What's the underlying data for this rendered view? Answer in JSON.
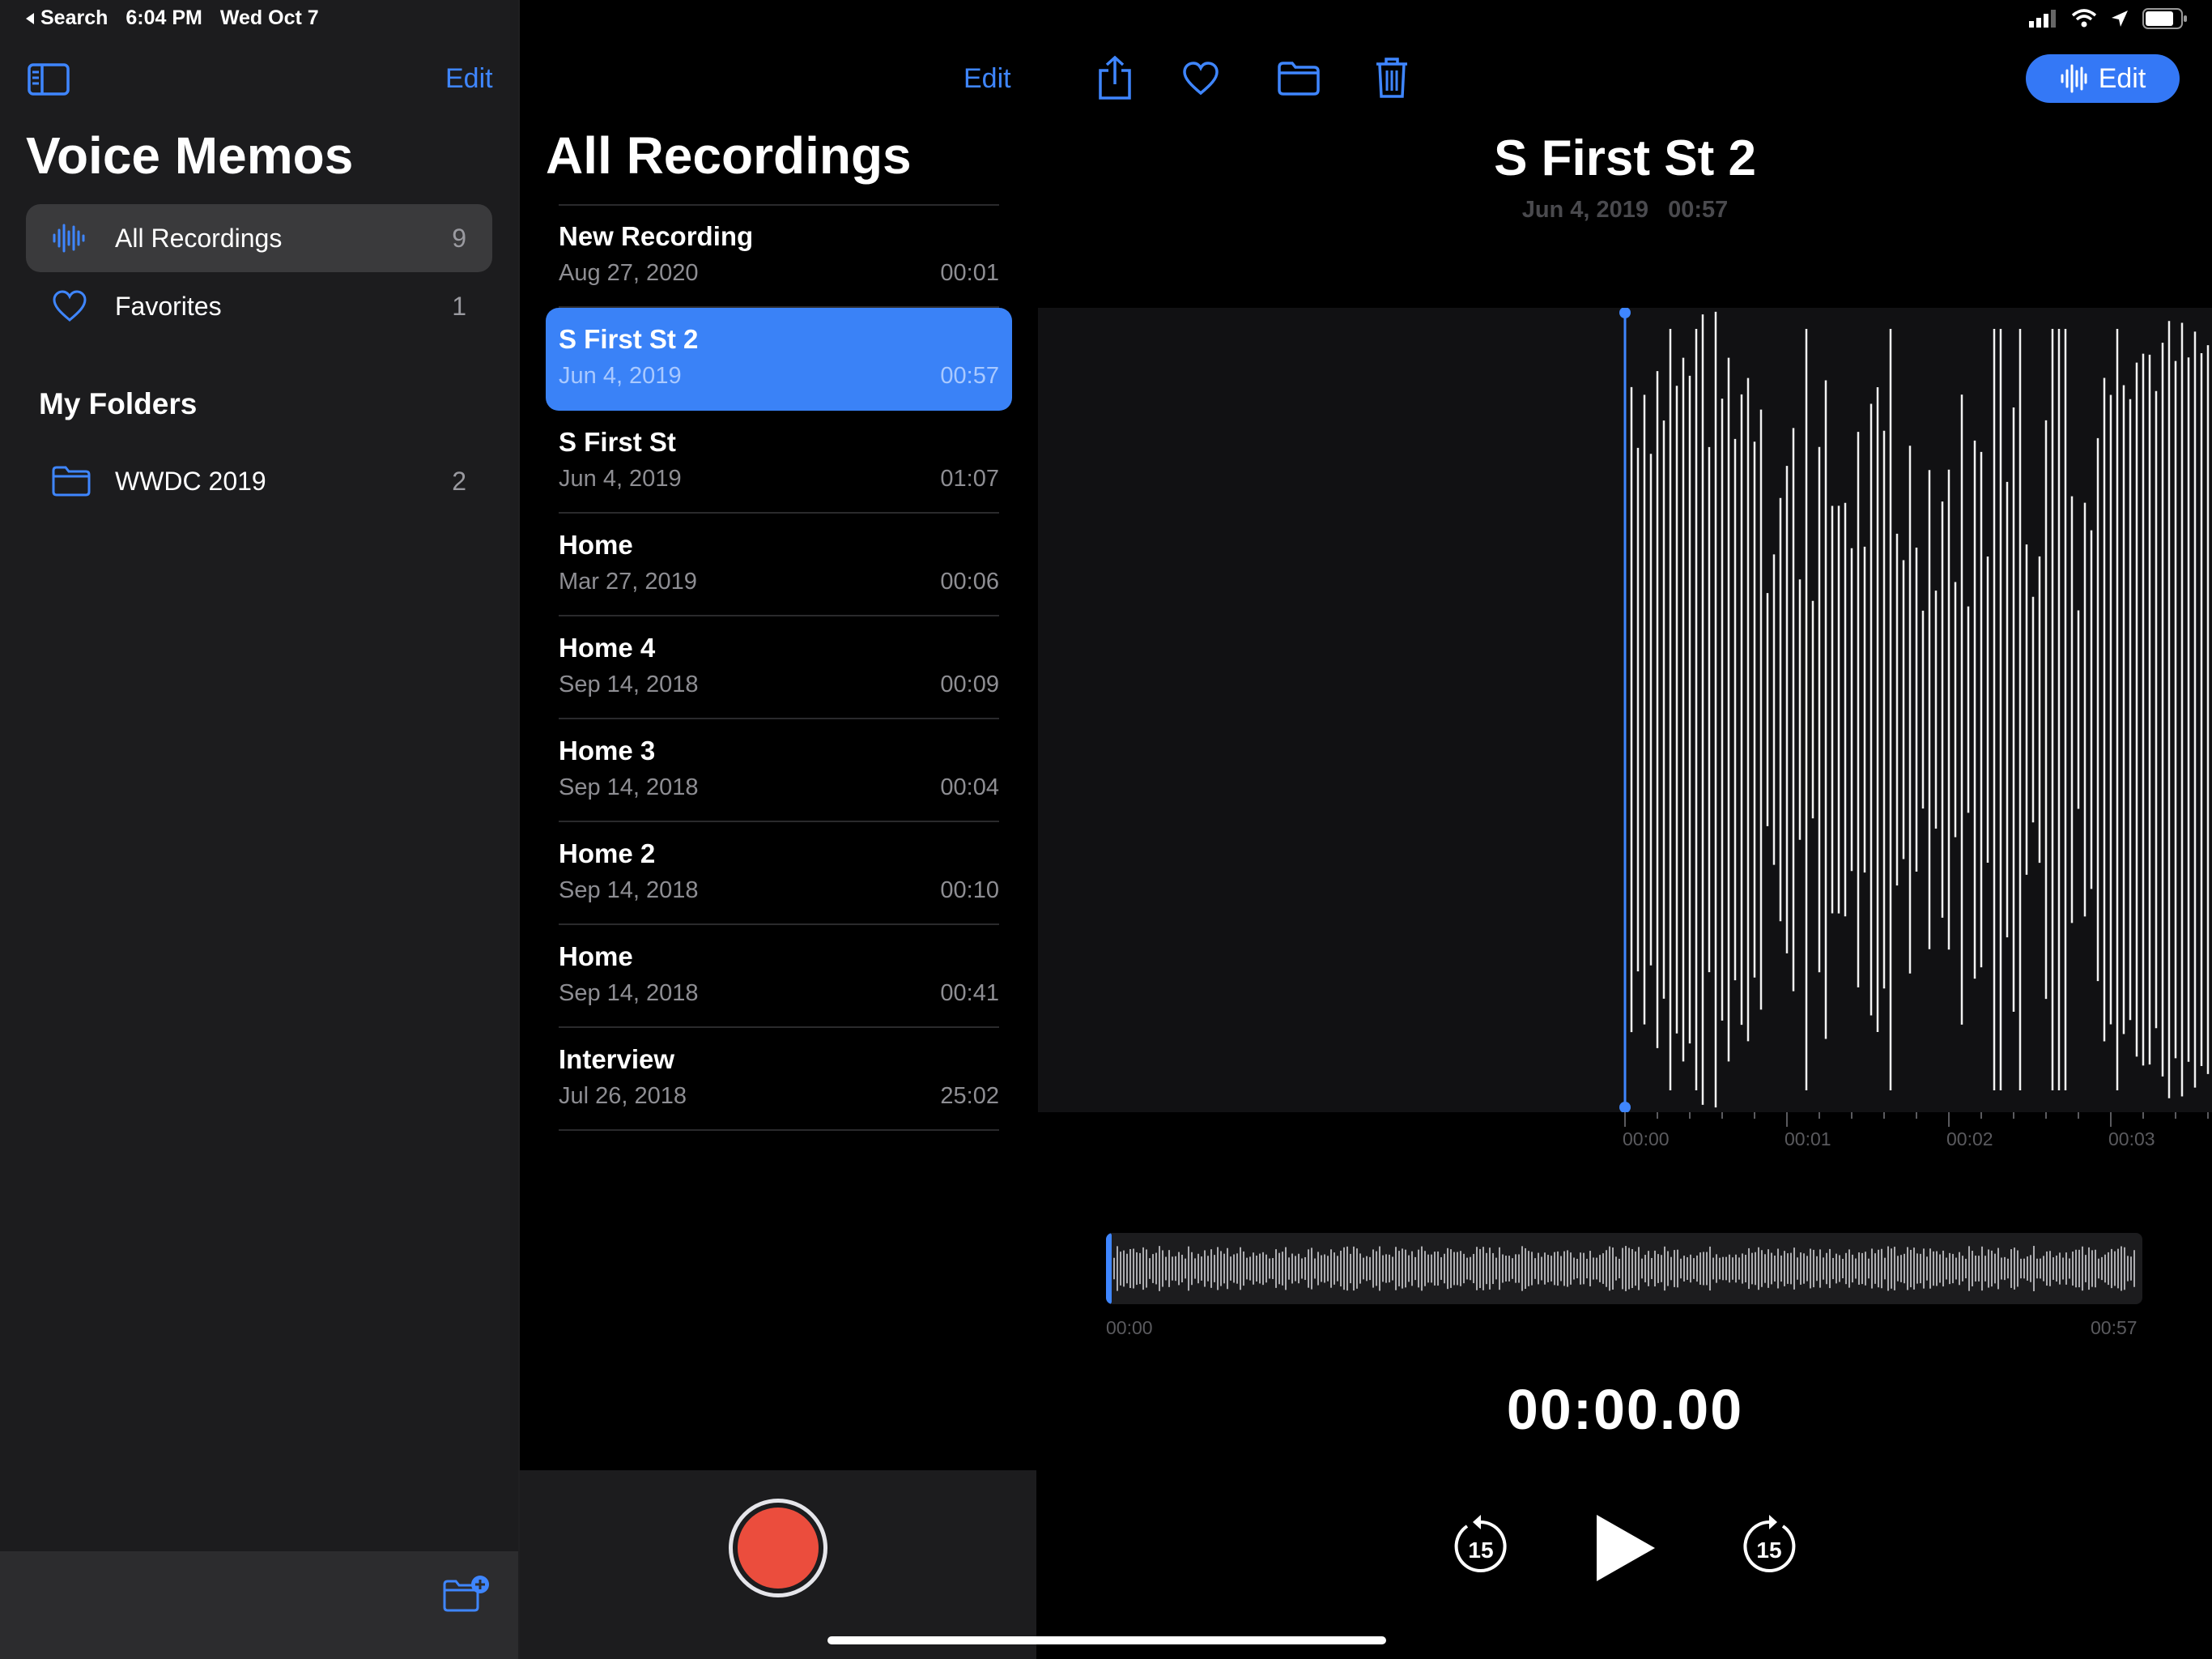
{
  "status_bar": {
    "back_label": "Search",
    "time": "6:04 PM",
    "date": "Wed Oct 7"
  },
  "sidebar": {
    "edit_label": "Edit",
    "title": "Voice Memos",
    "items": [
      {
        "icon": "waveform-icon",
        "label": "All Recordings",
        "count": "9",
        "selected": true
      },
      {
        "icon": "heart-icon",
        "label": "Favorites",
        "count": "1",
        "selected": false
      }
    ],
    "folders_title": "My Folders",
    "folders": [
      {
        "icon": "folder-icon",
        "label": "WWDC 2019",
        "count": "2"
      }
    ]
  },
  "list": {
    "edit_label": "Edit",
    "title": "All Recordings",
    "recordings": [
      {
        "name": "New Recording",
        "date": "Aug 27, 2020",
        "duration": "00:01"
      },
      {
        "name": "S First St 2",
        "date": "Jun 4, 2019",
        "duration": "00:57",
        "selected": true
      },
      {
        "name": "S First St",
        "date": "Jun 4, 2019",
        "duration": "01:07"
      },
      {
        "name": "Home",
        "date": "Mar 27, 2019",
        "duration": "00:06"
      },
      {
        "name": "Home 4",
        "date": "Sep 14, 2018",
        "duration": "00:09"
      },
      {
        "name": "Home 3",
        "date": "Sep 14, 2018",
        "duration": "00:04"
      },
      {
        "name": "Home 2",
        "date": "Sep 14, 2018",
        "duration": "00:10"
      },
      {
        "name": "Home",
        "date": "Sep 14, 2018",
        "duration": "00:41"
      },
      {
        "name": "Interview",
        "date": "Jul 26, 2018",
        "duration": "25:02"
      }
    ]
  },
  "detail": {
    "edit_label": "Edit",
    "title": "S First St 2",
    "date": "Jun 4, 2019",
    "duration": "00:57",
    "ticks": [
      "00:00",
      "00:01",
      "00:02",
      "00:03"
    ],
    "mini_start": "00:00",
    "mini_end": "00:57",
    "timer": "00:00.00",
    "skip_seconds": "15"
  },
  "colors": {
    "accent": "#3a82f7",
    "record": "#eb4d3d",
    "sidebar_bg": "#1c1c1e",
    "selected_row": "#3a3a3c"
  }
}
